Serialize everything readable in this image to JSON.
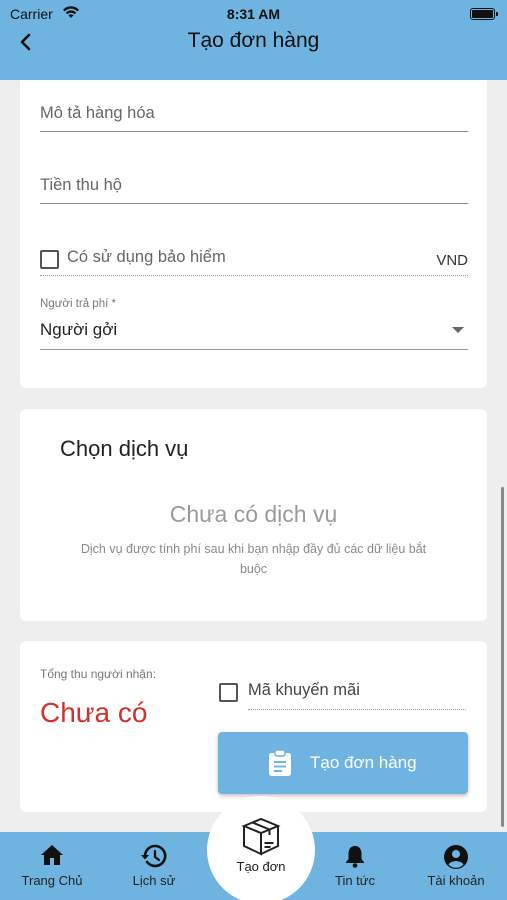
{
  "status_bar": {
    "carrier": "Carrier",
    "time": "8:31 AM"
  },
  "header": {
    "title": "Tạo đơn hàng"
  },
  "form": {
    "description_placeholder": "Mô tả hàng hóa",
    "cod_placeholder": "Tiền thu hộ",
    "insurance_label": "Có sử dụng bảo hiểm",
    "currency": "VND",
    "payer_label": "Người trả phí *",
    "payer_value": "Người gởi"
  },
  "service": {
    "title": "Chọn dịch vụ",
    "empty_title": "Chưa có dịch vụ",
    "empty_note": "Dịch vụ được tính phí sau khi bạn nhập đầy đủ các dữ liệu bắt buộc"
  },
  "total": {
    "label": "Tổng thu người nhận:",
    "value": "Chưa có",
    "promo_label": "Mã khuyến mãi",
    "create_button": "Tạo đơn hàng"
  },
  "nav": {
    "items": [
      {
        "label": "Trang Chủ",
        "icon": "home-icon"
      },
      {
        "label": "Lịch sử",
        "icon": "history-icon"
      },
      {
        "label": "Tạo đơn",
        "icon": "box-icon"
      },
      {
        "label": "Tin tức",
        "icon": "bell-icon"
      },
      {
        "label": "Tài khoản",
        "icon": "account-icon"
      }
    ]
  },
  "colors": {
    "primary": "#6fb3e0",
    "total_value": "#d0312d",
    "background": "#eeeeee"
  }
}
